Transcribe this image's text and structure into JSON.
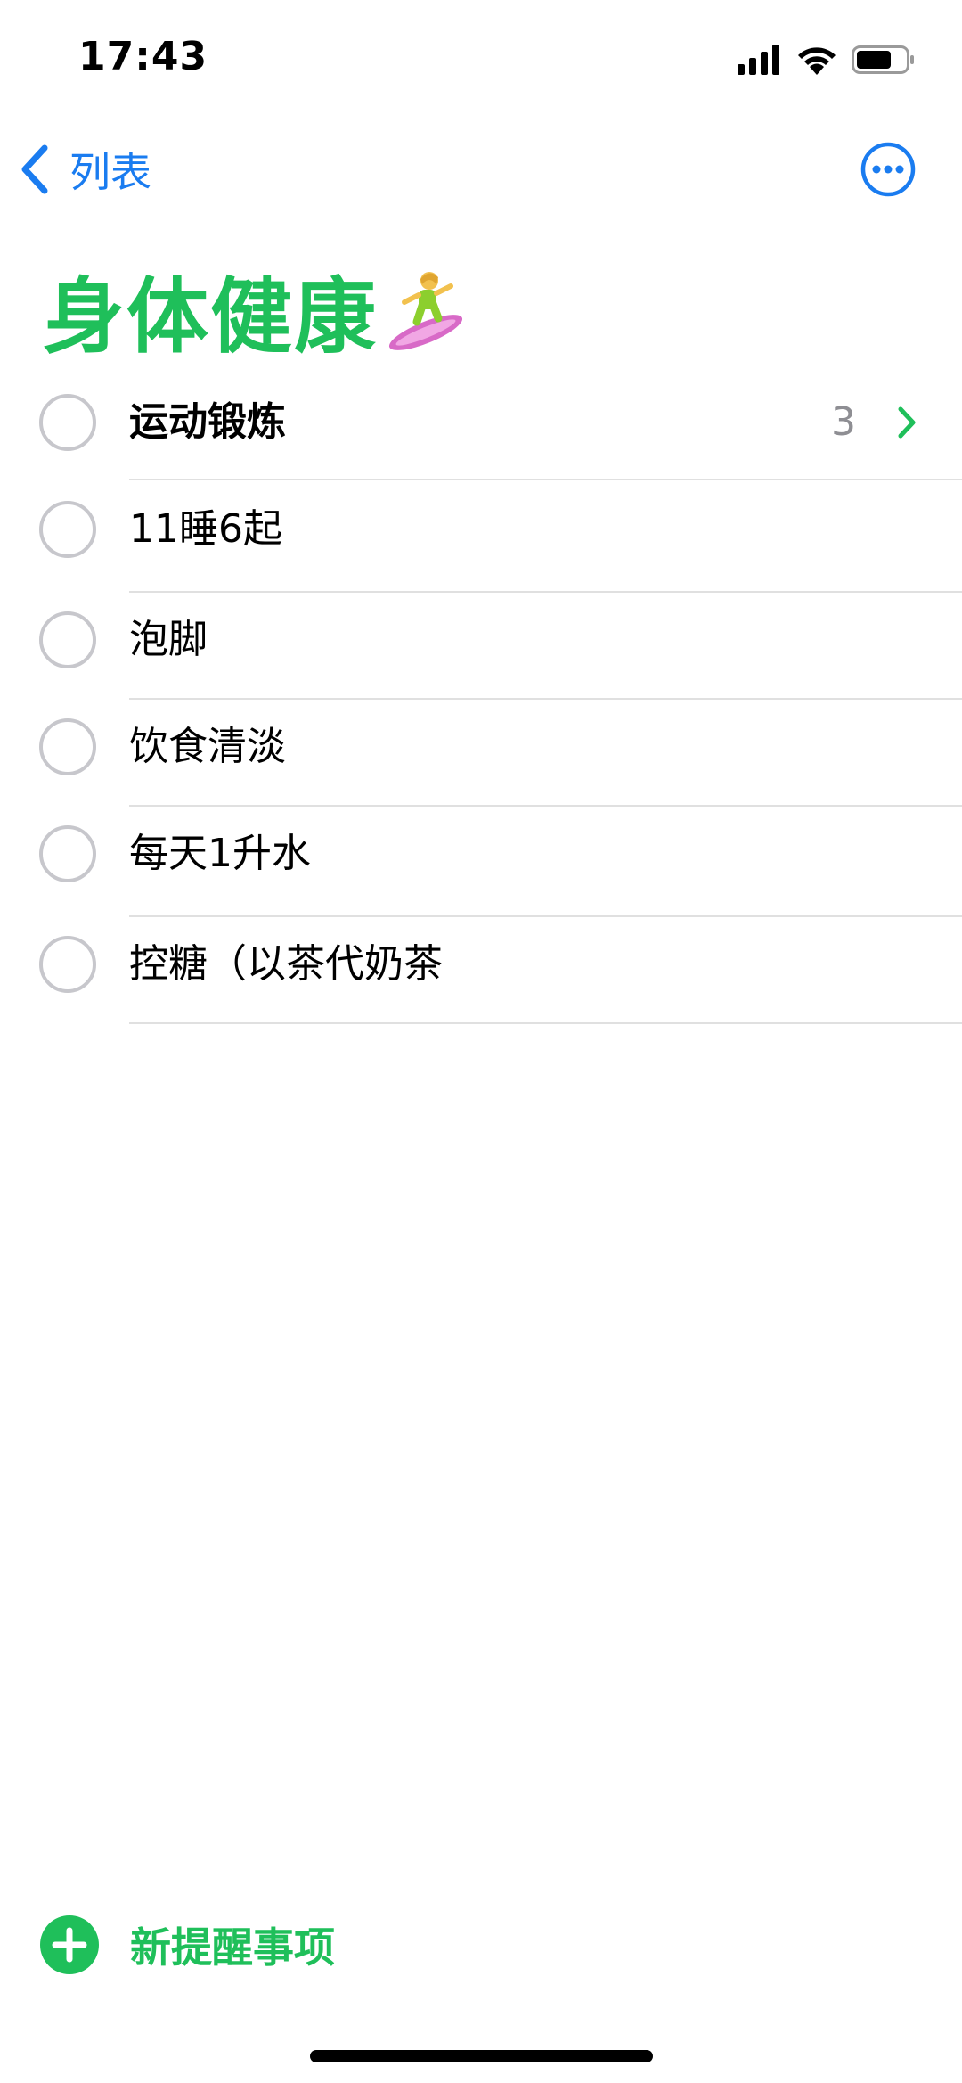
{
  "colors": {
    "accent_green": "#1fbf5a",
    "accent_blue": "#1a7cf0"
  },
  "status_bar": {
    "time": "17:43",
    "icons": [
      "cellular-signal-icon",
      "wifi-icon",
      "battery-icon"
    ]
  },
  "nav": {
    "back_label": "列表",
    "back_icon": "chevron-left-icon",
    "more_icon": "ellipsis-circle-icon"
  },
  "list": {
    "title": "身体健康",
    "title_emoji": "woman-surfing-icon"
  },
  "reminders": [
    {
      "title": "运动锻炼",
      "subtask_count": "3",
      "bold": true
    },
    {
      "title": "11睡6起"
    },
    {
      "title": "泡脚"
    },
    {
      "title": "饮食清淡"
    },
    {
      "title": "每天1升水"
    },
    {
      "title": "控糖（以茶代奶茶"
    }
  ],
  "footer": {
    "new_reminder_label": "新提醒事项",
    "new_reminder_icon": "plus-circle-icon"
  }
}
